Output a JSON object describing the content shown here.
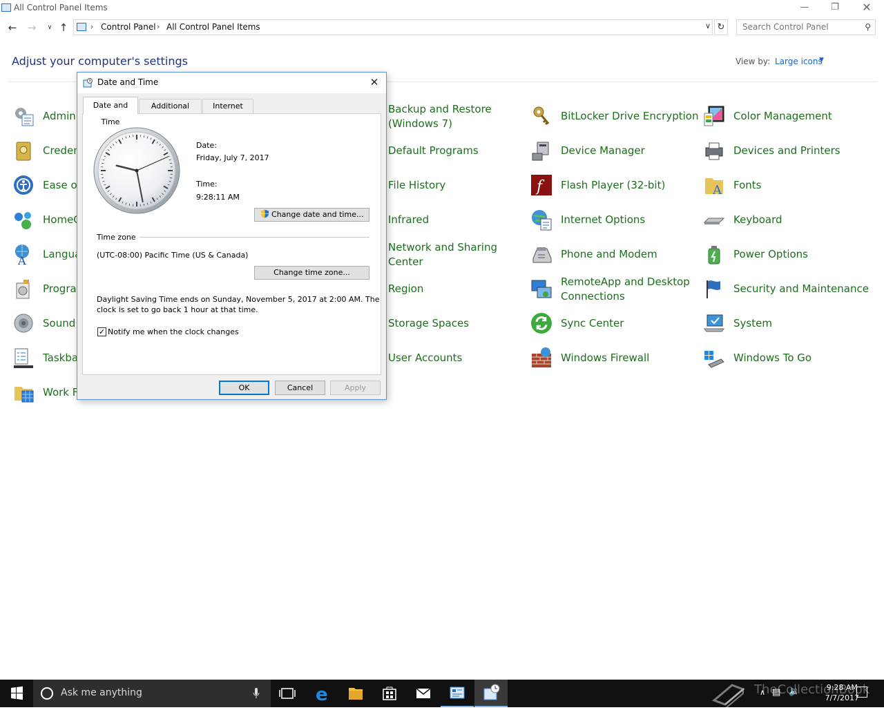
{
  "window": {
    "title": "All Control Panel Items"
  },
  "address": {
    "crumbs": [
      "Control Panel",
      "All Control Panel Items"
    ],
    "search_placeholder": "Search Control Panel"
  },
  "header": {
    "heading": "Adjust your computer's settings",
    "view_by_label": "View by:",
    "view_by_value": "Large icons"
  },
  "items": {
    "col1": [
      "Admini",
      "Creden",
      "Ease of",
      "HomeG",
      "Langua",
      "Progra",
      "Sound",
      "Taskbar",
      "Work F"
    ],
    "col3": [
      "Backup and Restore (Windows 7)",
      "Default Programs",
      "File History",
      "Infrared",
      "Network and Sharing Center",
      "Region",
      "Storage Spaces",
      "User Accounts"
    ],
    "col4": [
      "BitLocker Drive Encryption",
      "Device Manager",
      "Flash Player (32-bit)",
      "Internet Options",
      "Phone and Modem",
      "RemoteApp and Desktop Connections",
      "Sync Center",
      "Windows Firewall"
    ],
    "col5": [
      "Color Management",
      "Devices and Printers",
      "Fonts",
      "Keyboard",
      "Power Options",
      "Security and Maintenance",
      "System",
      "Windows To Go"
    ]
  },
  "dialog": {
    "title": "Date and Time",
    "tabs": [
      "Date and Time",
      "Additional Clocks",
      "Internet Time"
    ],
    "date_label": "Date:",
    "date_value": "Friday, July 7, 2017",
    "time_label": "Time:",
    "time_value": "9:28:11 AM",
    "change_datetime_button": "Change date and time...",
    "timezone_heading": "Time zone",
    "timezone_value": "(UTC-08:00) Pacific Time (US & Canada)",
    "change_timezone_button": "Change time zone...",
    "dst_line1": "Daylight Saving Time ends on Sunday, November 5, 2017 at 2:00 AM. The",
    "dst_line2": "clock is set to go back 1 hour at that time.",
    "notify_checkbox_label": "Notify me when the clock changes",
    "notify_checked": true,
    "ok": "OK",
    "cancel": "Cancel",
    "apply": "Apply",
    "clock": {
      "hours": 9,
      "minutes": 28,
      "seconds": 11
    }
  },
  "taskbar": {
    "search_placeholder": "Ask me anything",
    "tray_time": "9:28 AM",
    "tray_date": "7/7/2017",
    "watermark": "TheCollectionBook"
  },
  "colors": {
    "item_text": "#1d6e1d",
    "heading": "#1e3287",
    "link": "#1e64c8",
    "taskbar": "#101010"
  }
}
